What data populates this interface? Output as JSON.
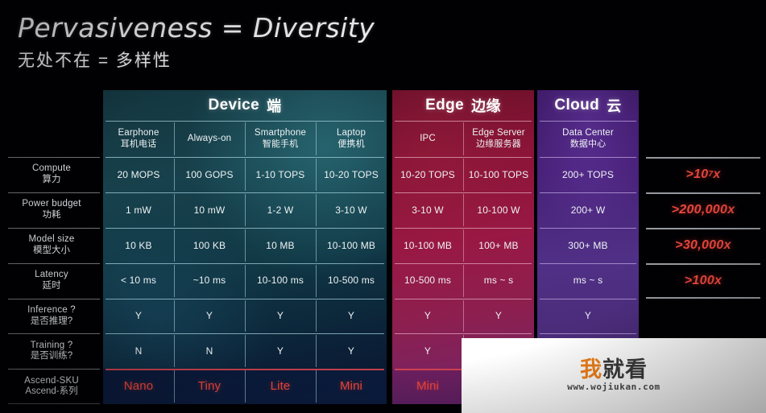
{
  "title": {
    "en": "Pervasiveness = Diversity",
    "cn": "无处不在 = 多样性"
  },
  "segments": [
    {
      "id": "device",
      "title_en": "Device",
      "title_cn": "端",
      "columns": [
        {
          "en": "Earphone",
          "cn": "耳机电话"
        },
        {
          "en": "Always-on",
          "cn": ""
        },
        {
          "en": "Smartphone",
          "cn": "智能手机"
        },
        {
          "en": "Laptop",
          "cn": "便携机"
        }
      ]
    },
    {
      "id": "edge",
      "title_en": "Edge",
      "title_cn": "边缘",
      "columns": [
        {
          "en": "IPC",
          "cn": ""
        },
        {
          "en": "Edge Server",
          "cn": "边缘服务器"
        }
      ]
    },
    {
      "id": "cloud",
      "title_en": "Cloud",
      "title_cn": "云",
      "columns": [
        {
          "en": "Data Center",
          "cn": "数据中心"
        }
      ]
    }
  ],
  "rows": [
    {
      "label_en": "Compute",
      "label_cn": "算力",
      "device": [
        "20 MOPS",
        "100 GOPS",
        "1-10 TOPS",
        "10-20 TOPS"
      ],
      "edge": [
        "10-20 TOPS",
        "10-100 TOPS"
      ],
      "cloud": [
        "200+ TOPS"
      ],
      "ratio": ">10",
      "ratio_sup": "7",
      "ratio_tail": " x"
    },
    {
      "label_en": "Power budget",
      "label_cn": "功耗",
      "device": [
        "1 mW",
        "10 mW",
        "1-2 W",
        "3-10 W"
      ],
      "edge": [
        "3-10 W",
        "10-100 W"
      ],
      "cloud": [
        "200+ W"
      ],
      "ratio": ">200,000x",
      "ratio_sup": "",
      "ratio_tail": ""
    },
    {
      "label_en": "Model size",
      "label_cn": "模型大小",
      "device": [
        "10 KB",
        "100 KB",
        "10 MB",
        "10-100 MB"
      ],
      "edge": [
        "10-100 MB",
        "100+ MB"
      ],
      "cloud": [
        "300+ MB"
      ],
      "ratio": ">30,000x",
      "ratio_sup": "",
      "ratio_tail": ""
    },
    {
      "label_en": "Latency",
      "label_cn": "延时",
      "device": [
        "< 10 ms",
        "~10 ms",
        "10-100 ms",
        "10-500 ms"
      ],
      "edge": [
        "10-500 ms",
        "ms ~ s"
      ],
      "cloud": [
        "ms ~ s"
      ],
      "ratio": ">100x",
      "ratio_sup": "",
      "ratio_tail": ""
    },
    {
      "label_en": "Inference ?",
      "label_cn": "是否推理?",
      "device": [
        "Y",
        "Y",
        "Y",
        "Y"
      ],
      "edge": [
        "Y",
        "Y"
      ],
      "cloud": [
        "Y"
      ],
      "ratio": "",
      "ratio_sup": "",
      "ratio_tail": ""
    },
    {
      "label_en": "Training ?",
      "label_cn": "是否训练?",
      "device": [
        "N",
        "N",
        "Y",
        "Y"
      ],
      "edge": [
        "Y",
        ""
      ],
      "cloud": [
        ""
      ],
      "ratio": "",
      "ratio_sup": "",
      "ratio_tail": ""
    },
    {
      "label_en": "Ascend-SKU",
      "label_cn": "Ascend-系列",
      "device": [
        "Nano",
        "Tiny",
        "Lite",
        "Mini"
      ],
      "edge": [
        "Mini",
        ""
      ],
      "cloud": [
        ""
      ],
      "ratio": "",
      "ratio_sup": "",
      "ratio_tail": ""
    }
  ],
  "watermark": {
    "logo_first": "我",
    "logo_rest": "就看",
    "url": "www.wojiukan.com"
  },
  "colors": {
    "device": "#17414c",
    "edge": "#991844",
    "cloud": "#4a2b78",
    "accent_red": "#e8483f",
    "watermark_orange": "#f0801a"
  }
}
